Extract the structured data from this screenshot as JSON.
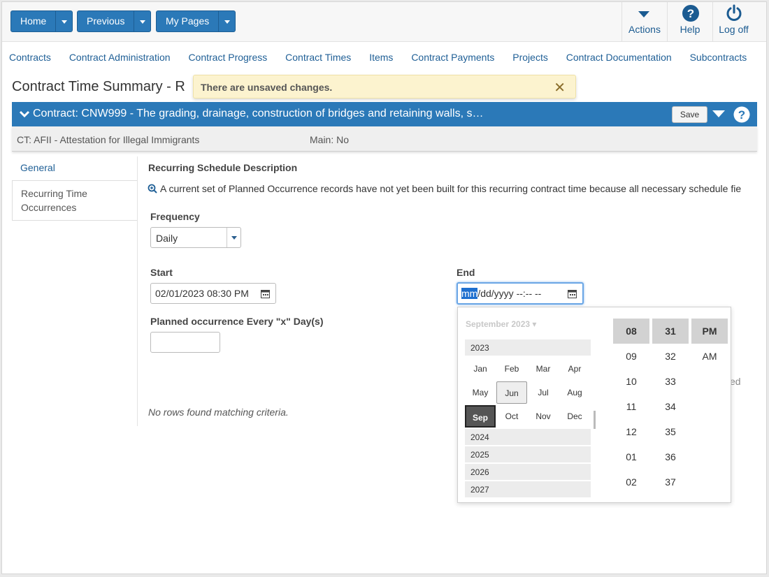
{
  "topbar": {
    "home_label": "Home",
    "previous_label": "Previous",
    "mypages_label": "My Pages",
    "actions_label": "Actions",
    "help_label": "Help",
    "logoff_label": "Log off"
  },
  "nav": [
    "Contracts",
    "Contract Administration",
    "Contract Progress",
    "Contract Times",
    "Items",
    "Contract Payments",
    "Projects",
    "Contract Documentation",
    "Subcontracts"
  ],
  "page": {
    "title": "Contract Time Summary - R",
    "unsaved_message": "There are unsaved changes."
  },
  "contract": {
    "header": "Contract: CNW999 - The grading, drainage, construction of bridges and retaining walls, s…",
    "save_label": "Save",
    "ct": "CT: AFII - Attestation for Illegal Immigrants",
    "main": "Main: No"
  },
  "tabs": [
    "General",
    "Recurring Time Occurrences"
  ],
  "form": {
    "section_title": "Recurring Schedule Description",
    "info_text": "A current set of Planned Occurrence records have not yet been built for this recurring contract time because all necessary schedule fie",
    "frequency_label": "Frequency",
    "frequency_value": "Daily",
    "start_label": "Start",
    "start_value": "02/01/2023 08:30  PM",
    "end_label": "End",
    "end_seg_mm": "mm",
    "end_rest": "/dd/yyyy --:-- --",
    "every_label": "Planned occurrence Every \"x\" Day(s)",
    "every_value": "",
    "no_rows": "No rows found matching criteria.",
    "bg_fragment": "ed"
  },
  "picker": {
    "header": "September 2023",
    "year_current": "2023",
    "months": [
      "Jan",
      "Feb",
      "Mar",
      "Apr",
      "May",
      "Jun",
      "Jul",
      "Aug",
      "Sep",
      "Oct",
      "Nov",
      "Dec"
    ],
    "highlighted_month": "Jun",
    "selected_month": "Sep",
    "years_after": [
      "2024",
      "2025",
      "2026",
      "2027"
    ],
    "hours": [
      "08",
      "09",
      "10",
      "11",
      "12",
      "01",
      "02"
    ],
    "minutes": [
      "31",
      "32",
      "33",
      "34",
      "35",
      "36",
      "37"
    ],
    "ampm": [
      "PM",
      "AM"
    ]
  },
  "colors": {
    "brand_blue": "#2b79b8",
    "link_blue": "#1f5f96",
    "warning_bg": "#fcf3cf"
  }
}
